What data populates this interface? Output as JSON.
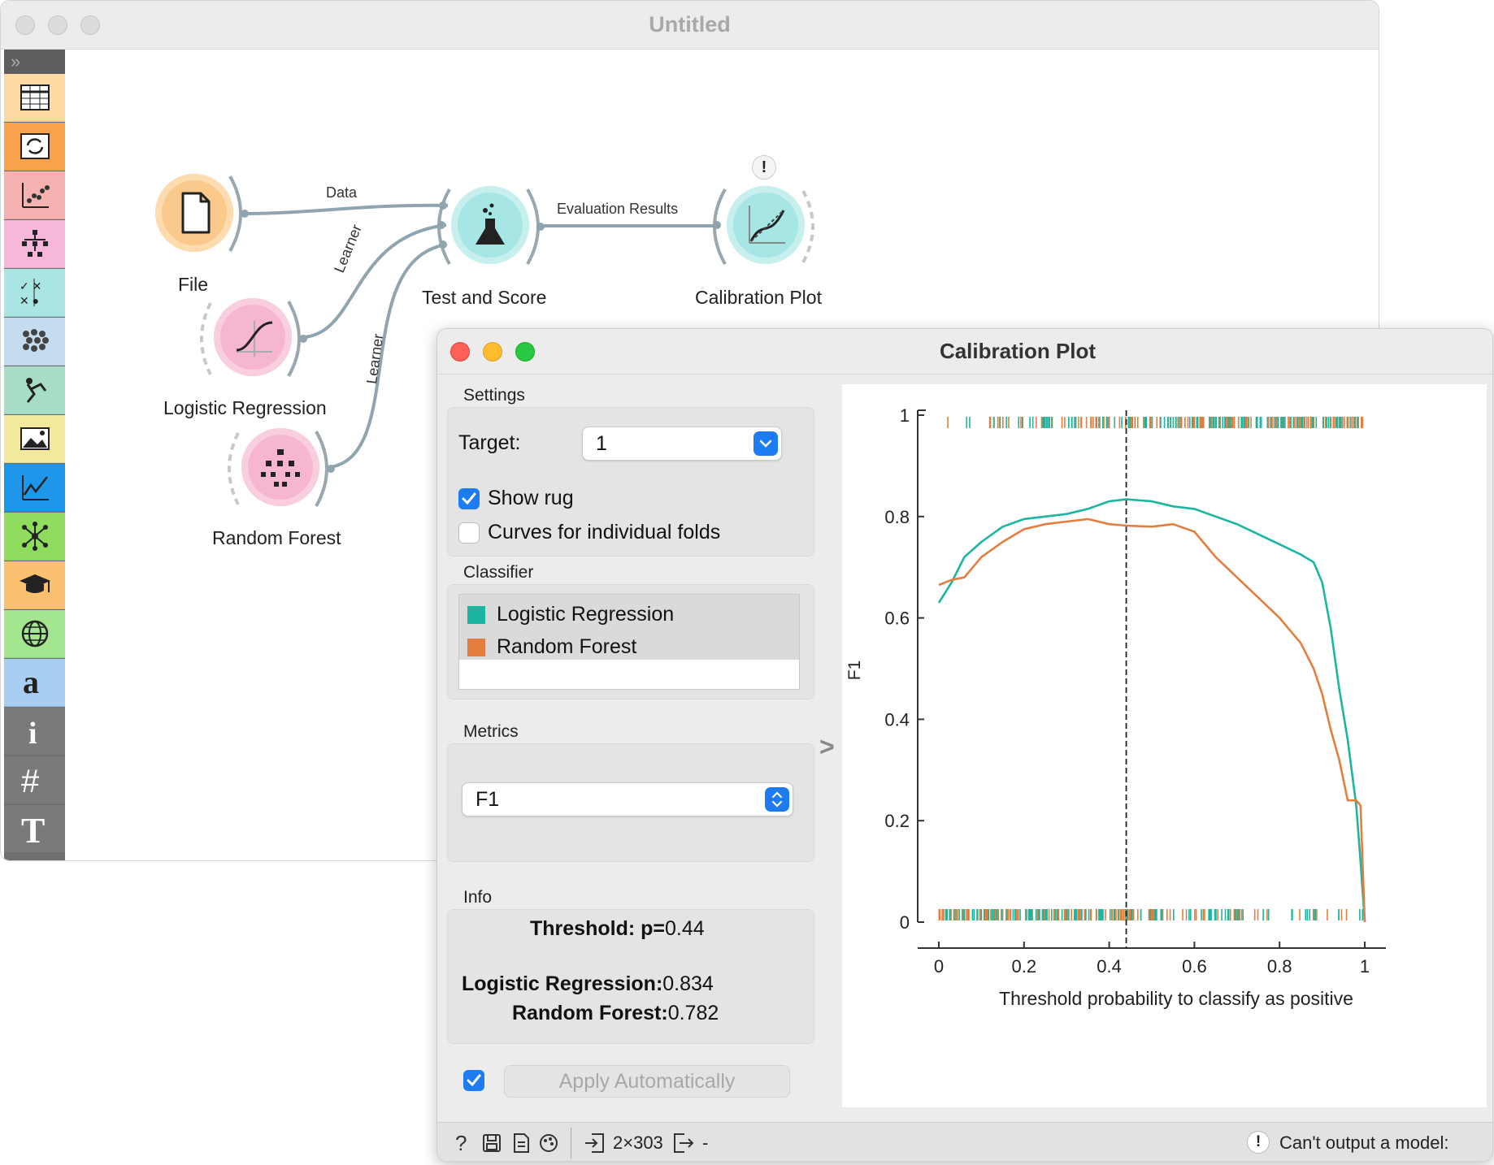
{
  "main_window": {
    "title": "Untitled"
  },
  "toolbox": {
    "categories": [
      {
        "name": "data",
        "icon": "table-icon",
        "color": "#fdd9a4"
      },
      {
        "name": "transform",
        "icon": "transform-icon",
        "color": "#f8a24a"
      },
      {
        "name": "visualize",
        "icon": "scatter-icon",
        "color": "#f6b1b1"
      },
      {
        "name": "model",
        "icon": "tree-icon",
        "color": "#f6b7d9"
      },
      {
        "name": "evaluate",
        "icon": "evaluate-icon",
        "color": "#a9e5e2"
      },
      {
        "name": "unsupervised",
        "icon": "cluster-icon",
        "color": "#c5dcf0"
      },
      {
        "name": "educational",
        "icon": "digger-icon",
        "color": "#a7ddc6"
      },
      {
        "name": "image-analytics",
        "icon": "image-icon",
        "color": "#f3e99d"
      },
      {
        "name": "timeseries",
        "icon": "linechart-icon",
        "color": "#1e96ea"
      },
      {
        "name": "network",
        "icon": "network-icon",
        "color": "#8fdc5e"
      },
      {
        "name": "education",
        "icon": "mortarboard-icon",
        "color": "#f9c06f"
      },
      {
        "name": "geo",
        "icon": "globe-icon",
        "color": "#a3e68f"
      },
      {
        "name": "text",
        "icon": "text-a-icon",
        "color": "#a8cff2"
      },
      {
        "name": "info",
        "icon": "info-icon",
        "color": "#7a7a7a"
      },
      {
        "name": "grid",
        "icon": "hash-icon",
        "color": "#7a7a7a"
      },
      {
        "name": "text-annotation",
        "icon": "text-t-icon",
        "color": "#7a7a7a"
      }
    ]
  },
  "workflow": {
    "nodes": {
      "file": "File",
      "logistic_regression": "Logistic Regression",
      "random_forest": "Random Forest",
      "test_and_score": "Test and Score",
      "calibration_plot": "Calibration Plot"
    },
    "links": {
      "data": "Data",
      "learner1": "Learner",
      "learner2": "Learner",
      "evaluation": "Evaluation Results"
    },
    "warning_mark": "!"
  },
  "calibration_window": {
    "title": "Calibration Plot",
    "settings": {
      "section": "Settings",
      "target_label": "Target:",
      "target_value": "1",
      "show_rug_label": "Show rug",
      "show_rug_checked": true,
      "folds_label": "Curves for individual folds",
      "folds_checked": false
    },
    "classifier": {
      "section": "Classifier",
      "items": [
        {
          "label": "Logistic Regression",
          "color": "#1ab69f"
        },
        {
          "label": "Random Forest",
          "color": "#e47e3f"
        }
      ]
    },
    "metrics": {
      "section": "Metrics",
      "value": "F1"
    },
    "info": {
      "section": "Info",
      "threshold_label": "Threshold: p=",
      "threshold_value": "0.44",
      "lr_label": "Logistic Regression:",
      "lr_value": "0.834",
      "rf_label": "Random Forest:",
      "rf_value": "0.782"
    },
    "apply": {
      "label": "Apply Automatically",
      "checked": true
    },
    "collapse_arrow": ">",
    "status": {
      "data_size": "2×303",
      "output": "-",
      "message": "Can't output a model:"
    }
  },
  "chart_data": {
    "type": "line",
    "xlabel": "Threshold probability to classify as positive",
    "ylabel": "F1",
    "xlim": [
      0,
      1
    ],
    "ylim": [
      0,
      1
    ],
    "xticks": [
      "0",
      "0.2",
      "0.4",
      "0.6",
      "0.8",
      "1"
    ],
    "yticks": [
      "0",
      "0.2",
      "0.4",
      "0.6",
      "0.8",
      "1"
    ],
    "threshold": 0.44,
    "series": [
      {
        "name": "Logistic Regression",
        "color": "#1ab69f",
        "x": [
          0,
          0.03,
          0.06,
          0.1,
          0.15,
          0.2,
          0.25,
          0.3,
          0.35,
          0.4,
          0.44,
          0.5,
          0.55,
          0.6,
          0.65,
          0.7,
          0.75,
          0.8,
          0.85,
          0.88,
          0.9,
          0.92,
          0.94,
          0.96,
          0.98,
          0.99,
          1.0
        ],
        "y": [
          0.63,
          0.67,
          0.72,
          0.75,
          0.78,
          0.795,
          0.8,
          0.805,
          0.815,
          0.83,
          0.834,
          0.83,
          0.82,
          0.815,
          0.8,
          0.785,
          0.765,
          0.745,
          0.725,
          0.71,
          0.67,
          0.58,
          0.46,
          0.36,
          0.23,
          0.12,
          0.0
        ]
      },
      {
        "name": "Random Forest",
        "color": "#e47e3f",
        "x": [
          0,
          0.03,
          0.06,
          0.1,
          0.15,
          0.2,
          0.25,
          0.3,
          0.35,
          0.4,
          0.44,
          0.5,
          0.55,
          0.6,
          0.65,
          0.7,
          0.75,
          0.8,
          0.85,
          0.88,
          0.9,
          0.92,
          0.94,
          0.96,
          0.98,
          0.99,
          1.0
        ],
        "y": [
          0.665,
          0.675,
          0.68,
          0.72,
          0.75,
          0.775,
          0.785,
          0.79,
          0.795,
          0.785,
          0.782,
          0.78,
          0.785,
          0.77,
          0.72,
          0.68,
          0.64,
          0.6,
          0.55,
          0.5,
          0.45,
          0.38,
          0.32,
          0.24,
          0.24,
          0.23,
          0.0
        ]
      }
    ]
  }
}
